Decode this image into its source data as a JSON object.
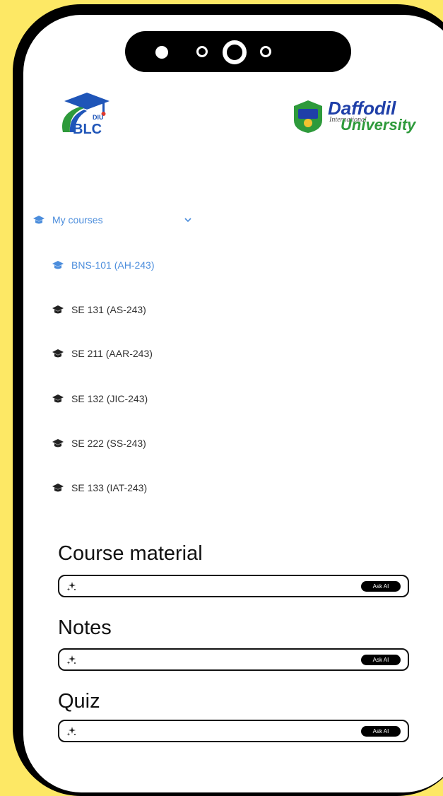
{
  "header": {
    "left_logo": {
      "badge": "DIU",
      "text": "BLC"
    },
    "right_logo": {
      "line1": "Daffodil",
      "line2": "University",
      "overlay": "International"
    }
  },
  "nav": {
    "my_courses_label": "My courses",
    "courses": [
      {
        "label": "BNS-101 (AH-243)",
        "active": true
      },
      {
        "label": "SE 131 (AS-243)",
        "active": false
      },
      {
        "label": "SE 211 (AAR-243)",
        "active": false
      },
      {
        "label": "SE 132 (JIC-243)",
        "active": false
      },
      {
        "label": "SE 222 (SS-243)",
        "active": false
      },
      {
        "label": "SE 133 (IAT-243)",
        "active": false
      }
    ]
  },
  "sections": [
    {
      "title": "Course material",
      "button": "Ask AI",
      "input_value": ""
    },
    {
      "title": "Notes",
      "button": "Ask AI",
      "input_value": ""
    },
    {
      "title": "Quiz",
      "button": "Ask AI",
      "input_value": ""
    }
  ],
  "colors": {
    "background": "#fde865",
    "accent_blue": "#4b8ddc",
    "brand_blue": "#1f3fa8",
    "brand_green": "#2e9a3b"
  },
  "icons": {
    "nav": "graduation-cap-icon",
    "dropdown": "chevron-down-icon",
    "ai": "sparkle-icon"
  }
}
